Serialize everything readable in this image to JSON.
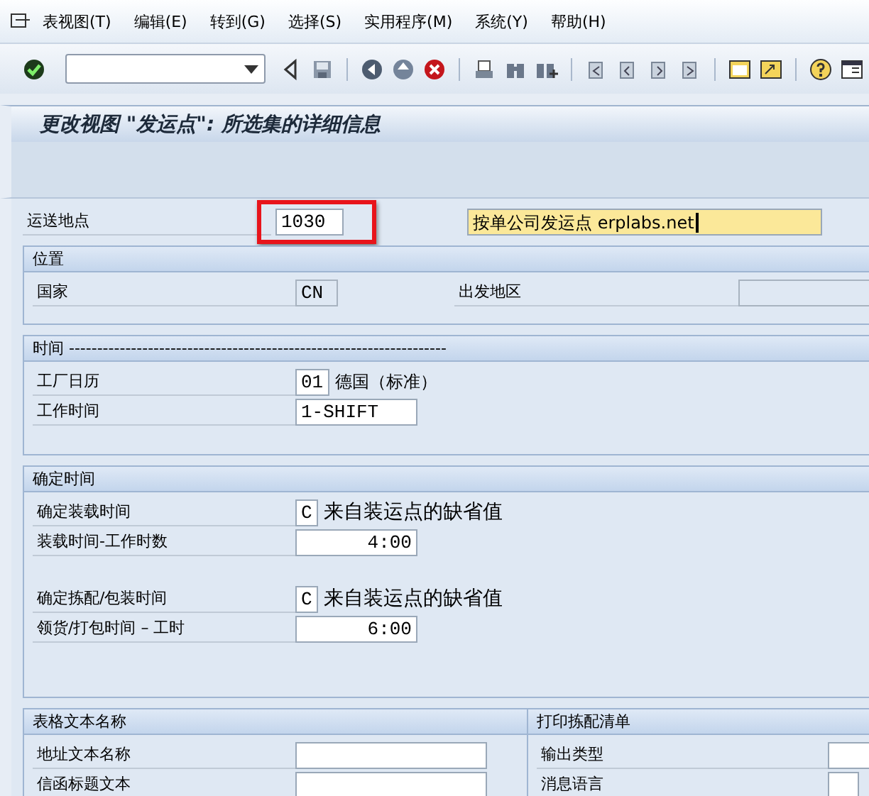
{
  "menu": [
    {
      "label": "表视图(T)"
    },
    {
      "label": "编辑(E)"
    },
    {
      "label": "转到(G)"
    },
    {
      "label": "选择(S)"
    },
    {
      "label": "实用程序(M)"
    },
    {
      "label": "系统(Y)"
    },
    {
      "label": "帮助(H)"
    }
  ],
  "title": "更改视图 \"发运点\": 所选集的详细信息",
  "header_field": {
    "label": "运送地点",
    "value": "1030",
    "highlighted": true,
    "description": "按单公司发运点 erplabs.net",
    "focused": true
  },
  "groups": [
    {
      "title": "位置",
      "sections": [
        {
          "rows": [
            {
              "cells": [
                {
                  "label": "国家",
                  "value": "CN",
                  "readonly": true
                },
                {
                  "label": "出发地区",
                  "readonly": true
                }
              ]
            }
          ]
        }
      ]
    },
    {
      "title": "时间 -------------------------------------------------------------------",
      "sections": [
        {
          "rows": [
            {
              "cells": [
                {
                  "label": "工厂日历",
                  "value": "01",
                  "readonly": false,
                  "suffix": "德国（标准）"
                }
              ]
            },
            {
              "cells": [
                {
                  "label": "工作时间",
                  "value": "1-SHIFT",
                  "readonly": false
                }
              ]
            }
          ]
        }
      ]
    },
    {
      "title": "确定时间",
      "sections": [
        {
          "rows": [
            {
              "cells": [
                {
                  "label": "确定装载时间",
                  "value": "C",
                  "readonly": false,
                  "suffix": "来自装运点的缺省值"
                }
              ]
            },
            {
              "cells": [
                {
                  "label": "装载时间-工作时数",
                  "value": "4:00",
                  "readonly": false,
                  "numeric": true
                }
              ]
            }
          ]
        },
        {
          "rows": [
            {
              "cells": [
                {
                  "label": "确定拣配/包装时间",
                  "value": "C",
                  "readonly": false,
                  "suffix": "来自装运点的缺省值"
                }
              ]
            },
            {
              "cells": [
                {
                  "label": "领货/打包时间 – 工时",
                  "value": "6:00",
                  "readonly": false,
                  "numeric": true
                }
              ]
            }
          ]
        }
      ]
    }
  ],
  "bottom_groups": [
    {
      "title": "表格文本名称",
      "sections": [
        {
          "rows": [
            {
              "cells": [
                {
                  "label": "地址文本名称",
                  "readonly": false
                }
              ]
            },
            {
              "cells": [
                {
                  "label": "信函标题文本",
                  "readonly": false
                }
              ]
            }
          ]
        }
      ]
    },
    {
      "title": "打印拣配清单",
      "sections": [
        {
          "rows": [
            {
              "cells": [
                {
                  "label": "输出类型",
                  "readonly": false
                }
              ]
            },
            {
              "cells": [
                {
                  "label": "消息语言",
                  "readonly": false
                }
              ]
            }
          ]
        }
      ]
    }
  ]
}
